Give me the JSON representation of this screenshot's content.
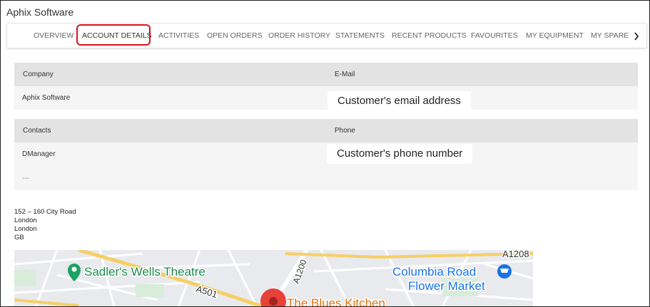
{
  "app": {
    "title": "Aphix Software"
  },
  "tabs": [
    {
      "label": "OVERVIEW",
      "active": false
    },
    {
      "label": "ACCOUNT DETAILS",
      "active": true
    },
    {
      "label": "ACTIVITIES",
      "active": false
    },
    {
      "label": "OPEN ORDERS",
      "active": false
    },
    {
      "label": "ORDER HISTORY",
      "active": false
    },
    {
      "label": "STATEMENTS",
      "active": false
    },
    {
      "label": "RECENT PRODUCTS",
      "active": false
    },
    {
      "label": "FAVOURITES",
      "active": false
    },
    {
      "label": "MY EQUIPMENT",
      "active": false
    },
    {
      "label": "MY SPARE",
      "active": false
    }
  ],
  "tabs_more_icon": "chevron-right",
  "details": {
    "company_header": "Company",
    "company_value": "Aphix Software",
    "email_header": "E-Mail",
    "contacts_header": "Contacts",
    "contacts_value": "DManager",
    "contacts_extra": "---",
    "phone_header": "Phone"
  },
  "callouts": {
    "email": "Customer's email address",
    "phone": "Customer's phone number"
  },
  "address": {
    "line1": "152 – 160 City Road",
    "line2": "London",
    "line3": "London",
    "line4": "GB"
  },
  "map": {
    "label_theatre": "Sadler's Wells Theatre",
    "label_market_1": "Columbia Road",
    "label_market_2": "Flower Market",
    "label_kitchen": "The Blues Kitchen",
    "road_a1208": "A1208",
    "road_a1200": "A1200",
    "road_a501": "A501",
    "colors": {
      "road": "#f6cf65",
      "poi_green": "#1ea362",
      "poi_blue": "#1a73e8",
      "pin": "#e8413a",
      "food": "#e8710a"
    }
  }
}
